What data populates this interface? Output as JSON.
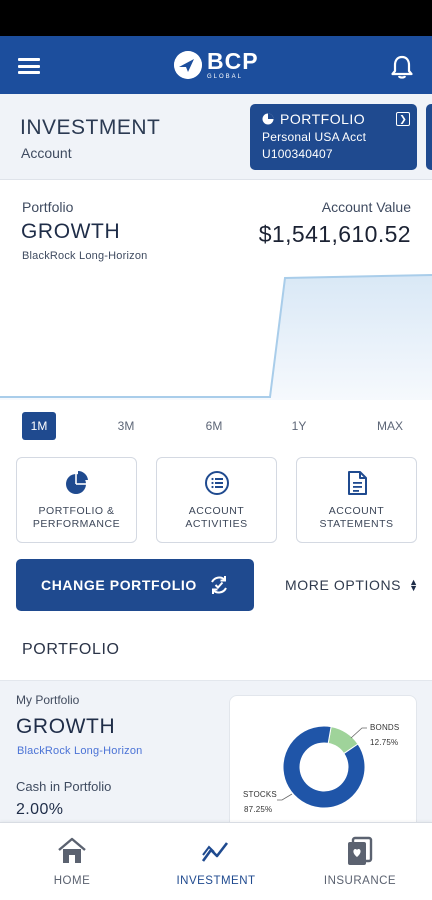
{
  "header": {
    "brand": "BCP",
    "brand_sub": "GLOBAL"
  },
  "account": {
    "title": "INVESTMENT",
    "subtitle": "Account",
    "card": {
      "title": "PORTFOLIO",
      "line1": "Personal USA Acct",
      "line2": "U100340407"
    }
  },
  "summary": {
    "portfolio_label": "Portfolio",
    "portfolio_name": "GROWTH",
    "strategy": "BlackRock Long-Horizon",
    "account_value_label": "Account Value",
    "account_value": "$1,541,610.52"
  },
  "ranges": [
    "1M",
    "3M",
    "6M",
    "1Y",
    "MAX"
  ],
  "active_range": "1M",
  "tiles": [
    {
      "label": "PORTFOLIO &\nPERFORMANCE",
      "icon": "pie-chart-icon"
    },
    {
      "label": "ACCOUNT\nACTIVITIES",
      "icon": "list-icon"
    },
    {
      "label": "ACCOUNT\nSTATEMENTS",
      "icon": "document-icon"
    }
  ],
  "actions": {
    "change_portfolio": "CHANGE PORTFOLIO",
    "more_options": "MORE OPTIONS"
  },
  "portfolio_section": {
    "title": "PORTFOLIO",
    "my_portfolio_label": "My Portfolio",
    "name": "GROWTH",
    "strategy": "BlackRock Long-Horizon",
    "cash_label": "Cash in Portfolio",
    "cash_value": "2.00%",
    "allocation": [
      {
        "name": "BONDS",
        "pct_label": "12.75%",
        "value": 12.75,
        "color": "#9fd39a"
      },
      {
        "name": "STOCKS",
        "pct_label": "87.25%",
        "value": 87.25,
        "color": "#1f55a8"
      }
    ]
  },
  "tabs": [
    {
      "label": "HOME",
      "icon": "home-icon"
    },
    {
      "label": "INVESTMENT",
      "icon": "trend-icon"
    },
    {
      "label": "INSURANCE",
      "icon": "insurance-icon"
    }
  ],
  "active_tab": "INVESTMENT",
  "colors": {
    "brand_blue": "#1c4e9d",
    "button_blue": "#1f4a8f",
    "chart_line": "#a9cdea",
    "bonds_green": "#9fd39a",
    "stocks_blue": "#1f55a8"
  }
}
